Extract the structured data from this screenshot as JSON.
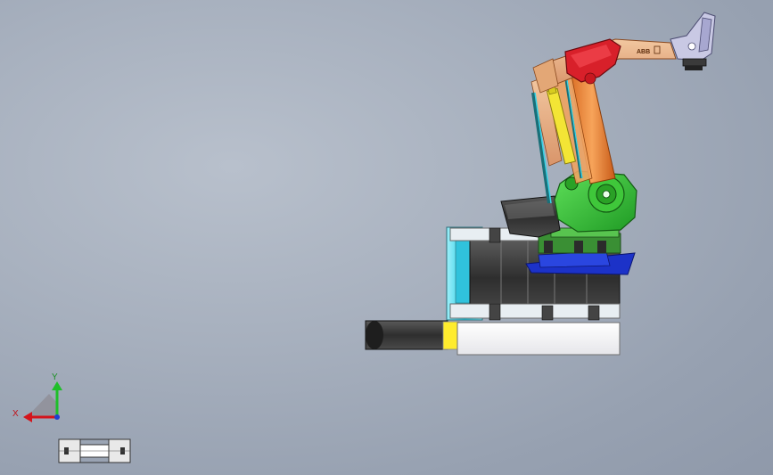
{
  "viewport": {
    "triad": {
      "x_label": "X",
      "y_label": "Y"
    },
    "robot": {
      "brand_label": "ABB"
    },
    "colors": {
      "background": "#a7b0be",
      "robot_orange": "#e58a3c",
      "robot_red": "#d8202a",
      "robot_green": "#3ec43a",
      "robot_yellow": "#f2e23a",
      "robot_cyan": "#2fd0e6",
      "base_blue": "#1c32c8",
      "conveyor_dark": "#3a3a3a"
    }
  }
}
